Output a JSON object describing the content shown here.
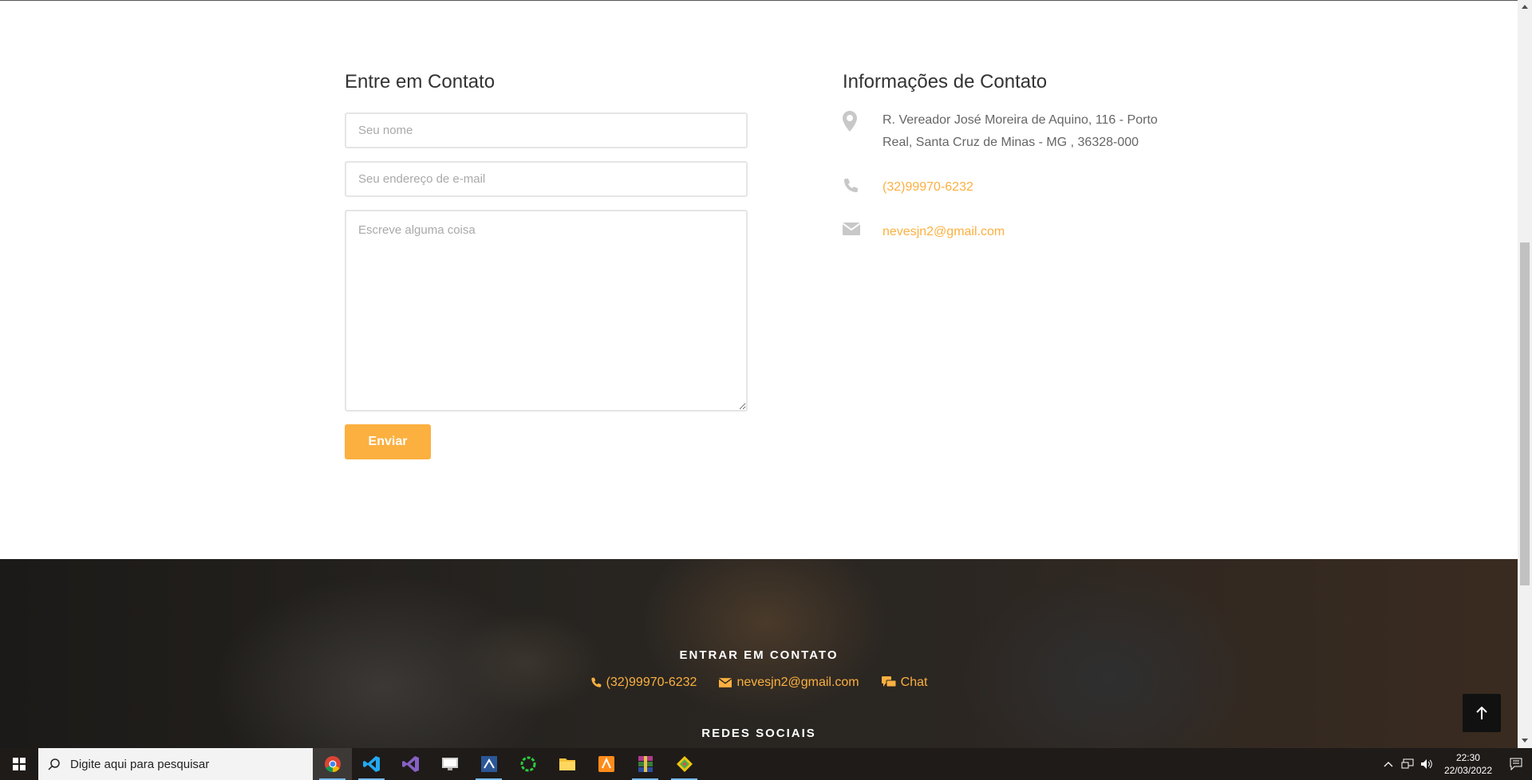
{
  "form": {
    "title": "Entre em Contato",
    "name_placeholder": "Seu nome",
    "email_placeholder": "Seu endereço de e-mail",
    "message_placeholder": "Escreve alguma coisa",
    "submit_label": "Enviar"
  },
  "info": {
    "title": "Informações de Contato",
    "address": "R. Vereador José Moreira de Aquino, 116 - Porto Real, Santa Cruz de Minas - MG , 36328-000",
    "phone": "(32)99970-6232",
    "email": "nevesjn2@gmail.com"
  },
  "footer": {
    "contact_heading": "ENTRAR EM CONTATO",
    "phone": "(32)99970-6232",
    "email": "nevesjn2@gmail.com",
    "chat": "Chat",
    "social_heading": "REDES SOCIAIS"
  },
  "colors": {
    "accent": "#fbb040",
    "footer_bg": "#262321",
    "taskbar": "#1f1b19"
  },
  "taskbar": {
    "search_placeholder": "Digite aqui para pesquisar",
    "apps": [
      "chrome-icon",
      "vscode-icon",
      "visual-studio-icon",
      "remote-desktop-icon",
      "ssms-icon",
      "loading-ring-icon",
      "file-explorer-icon",
      "sublime-icon",
      "winrar-icon",
      "git-icon"
    ],
    "time": "22:30",
    "date": "22/03/2022"
  }
}
